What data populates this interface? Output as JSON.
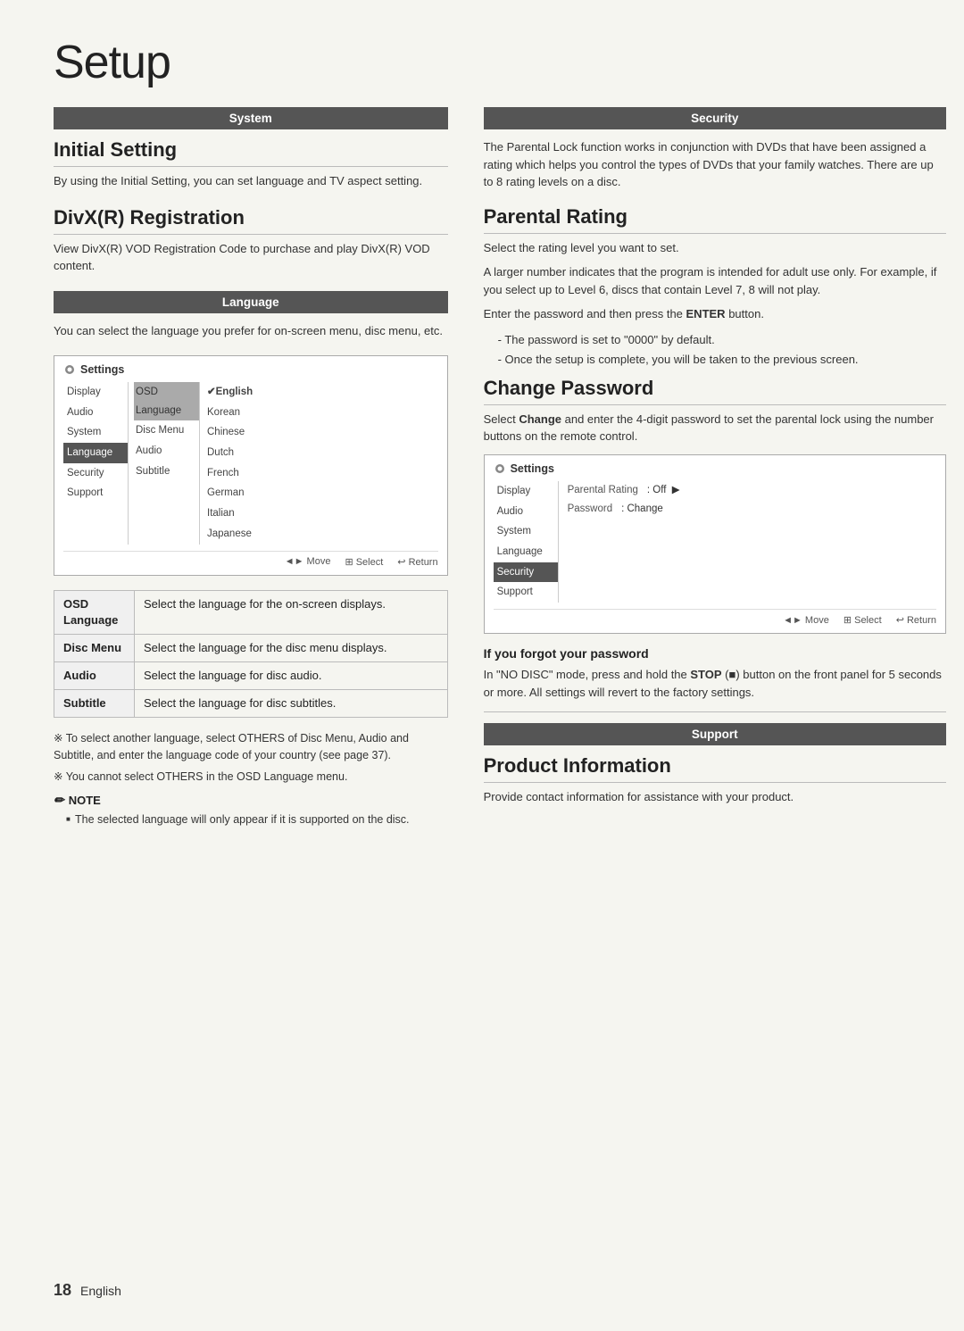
{
  "page": {
    "title": "Setup",
    "page_number": "18",
    "page_language": "English"
  },
  "left_col": {
    "system_header": "System",
    "initial_setting": {
      "title": "Initial Setting",
      "body": "By using the Initial Setting, you can set language and TV aspect setting."
    },
    "divx_registration": {
      "title": "DivX(R) Registration",
      "body": "View DivX(R) VOD Registration Code to purchase and play DivX(R) VOD content."
    },
    "language_header": "Language",
    "language_intro": "You can select the language you prefer for on-screen menu, disc menu, etc.",
    "settings_box": {
      "title": "Settings",
      "menu_items": [
        "Display",
        "Audio",
        "System",
        "Language",
        "Security",
        "Support"
      ],
      "active_menu": "Language",
      "submenu_items": [
        "Disc Menu",
        "Audio",
        "Subtitle"
      ],
      "active_submenu": "OSD Language",
      "osd_label": "OSD Language",
      "options": [
        {
          "label": "✔English",
          "checked": true
        },
        {
          "label": "Korean"
        },
        {
          "label": "Chinese"
        },
        {
          "label": "Dutch"
        },
        {
          "label": "French"
        },
        {
          "label": "German"
        },
        {
          "label": "Italian"
        },
        {
          "label": "Japanese"
        }
      ],
      "footer": [
        "◄► Move",
        "⊞ Select",
        "↩ Return"
      ]
    },
    "lang_table": [
      {
        "key": "OSD\nLanguage",
        "value": "Select the language for the on-screen displays."
      },
      {
        "key": "Disc Menu",
        "value": "Select the language for the disc menu displays."
      },
      {
        "key": "Audio",
        "value": "Select the language for disc audio."
      },
      {
        "key": "Subtitle",
        "value": "Select the language for disc subtitles."
      }
    ],
    "note_others": "※ To select another language, select OTHERS of Disc Menu, Audio and Subtitle, and enter the language code of your country (see page 37).",
    "note_osd": "※ You cannot select OTHERS in the OSD Language menu.",
    "note_title": "NOTE",
    "note_body": "The selected language will only appear if it is supported on the disc."
  },
  "right_col": {
    "security_header": "Security",
    "security_intro": "The Parental Lock function works in conjunction with DVDs that have been assigned a rating which helps you control the types of DVDs that your family watches. There are up to 8 rating levels on a disc.",
    "parental_rating": {
      "title": "Parental Rating",
      "body1": "Select the rating level you want to set.",
      "body2": "A larger number indicates that the program is intended for adult use only. For example, if you select up to Level 6, discs that contain Level 7, 8 will not play.",
      "body3": "Enter the password and then press the ENTER button.",
      "enter_bold": "ENTER",
      "bullets": [
        "The password is set to \"0000\" by default.",
        "Once the setup is complete, you will be taken to the previous screen."
      ]
    },
    "change_password": {
      "title": "Change Password",
      "body": "Select Change and enter the 4-digit password to set the parental lock using the number buttons on the remote control.",
      "change_bold": "Change",
      "settings_box": {
        "title": "Settings",
        "menu_items": [
          "Display",
          "Audio",
          "System",
          "Language",
          "Security",
          "Support"
        ],
        "active_menu": "Security",
        "rows": [
          {
            "label": "Parental Rating",
            "value": ": Off  ▶"
          },
          {
            "label": "Password",
            "value": ": Change"
          }
        ],
        "footer": [
          "◄► Move",
          "⊞ Select",
          "↩ Return"
        ]
      }
    },
    "if_forgot": {
      "title": "If you forgot your password",
      "body1": "In \"NO DISC\" mode, press and hold the STOP",
      "stop_bold": "STOP",
      "body2": "(■) button on the front panel for 5 seconds or more. All settings will revert to the factory settings."
    },
    "support_header": "Support",
    "product_information": {
      "title": "Product Information",
      "body": "Provide contact information for assistance with your product."
    }
  }
}
